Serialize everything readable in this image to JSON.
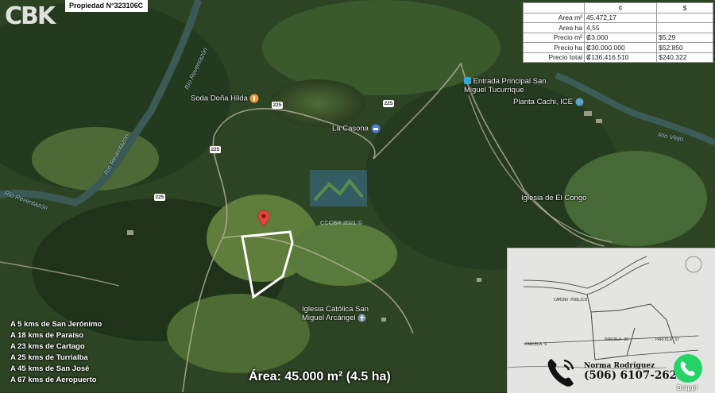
{
  "header": {
    "logo_text": "CBK",
    "property_label": "Propiedad N°323106C"
  },
  "price_table": {
    "col_colones": "¢",
    "col_dollars": "$",
    "rows": [
      {
        "label": "Area m²",
        "colones": "45.472,17",
        "dollars": ""
      },
      {
        "label": "Area ha",
        "colones": "4,55",
        "dollars": ""
      },
      {
        "label": "Precio m²",
        "colones": "₡3.000",
        "dollars": "$5,29"
      },
      {
        "label": "Precio ha",
        "colones": "₡30.000.000",
        "dollars": "$52.850"
      },
      {
        "label": "Precio total",
        "colones": "₡136.416.510",
        "dollars": "$240.322"
      }
    ]
  },
  "places": {
    "soda": "Soda Doña Hilda",
    "la_casona": "La Casona",
    "entrada": "Entrada Principal San Miguel Tucurrique",
    "planta": "Planta Cachi, ICE",
    "iglesia_congo": "Iglesia de El Congo",
    "iglesia_catolica": "Iglesia Católica San Miguel Arcángel"
  },
  "rivers": {
    "river_1": "Río Reventazón",
    "river_2": "Río Reventazón",
    "river_3": "Río Reventazón",
    "river_4": "Río Viejo"
  },
  "road_shields": [
    "225",
    "225",
    "225",
    "225"
  ],
  "map_watermark": "CCCBR 2021 ©",
  "distances": [
    "A 5 kms de San Jerónimo",
    "A 18 kms de Paraíso",
    "A 23 kms de Cartago",
    "A 25 kms de Turrialba",
    "A 45 kms de San José",
    "A 67 kms de Aeropuerto"
  ],
  "area_caption": "Área: 45.000 m² (4.5 ha)",
  "plan_labels": {
    "parcela_a": "PARCELA 9",
    "parcela_b": "PARCELA 36",
    "parcela_c": "PARCELA 37",
    "camino": "CAMINO PUBLICO"
  },
  "contact": {
    "name": "Norma Rodríguez",
    "phone": "(506) 6107-2627"
  },
  "corner_watermark": "Brappi",
  "colors": {
    "parcel_outline": "#ffffff",
    "pin": "#e8453c",
    "whatsapp": "#25d366"
  },
  "icons": {
    "pin": "map-pin-icon",
    "phone": "phone-icon",
    "whatsapp": "whatsapp-icon"
  }
}
